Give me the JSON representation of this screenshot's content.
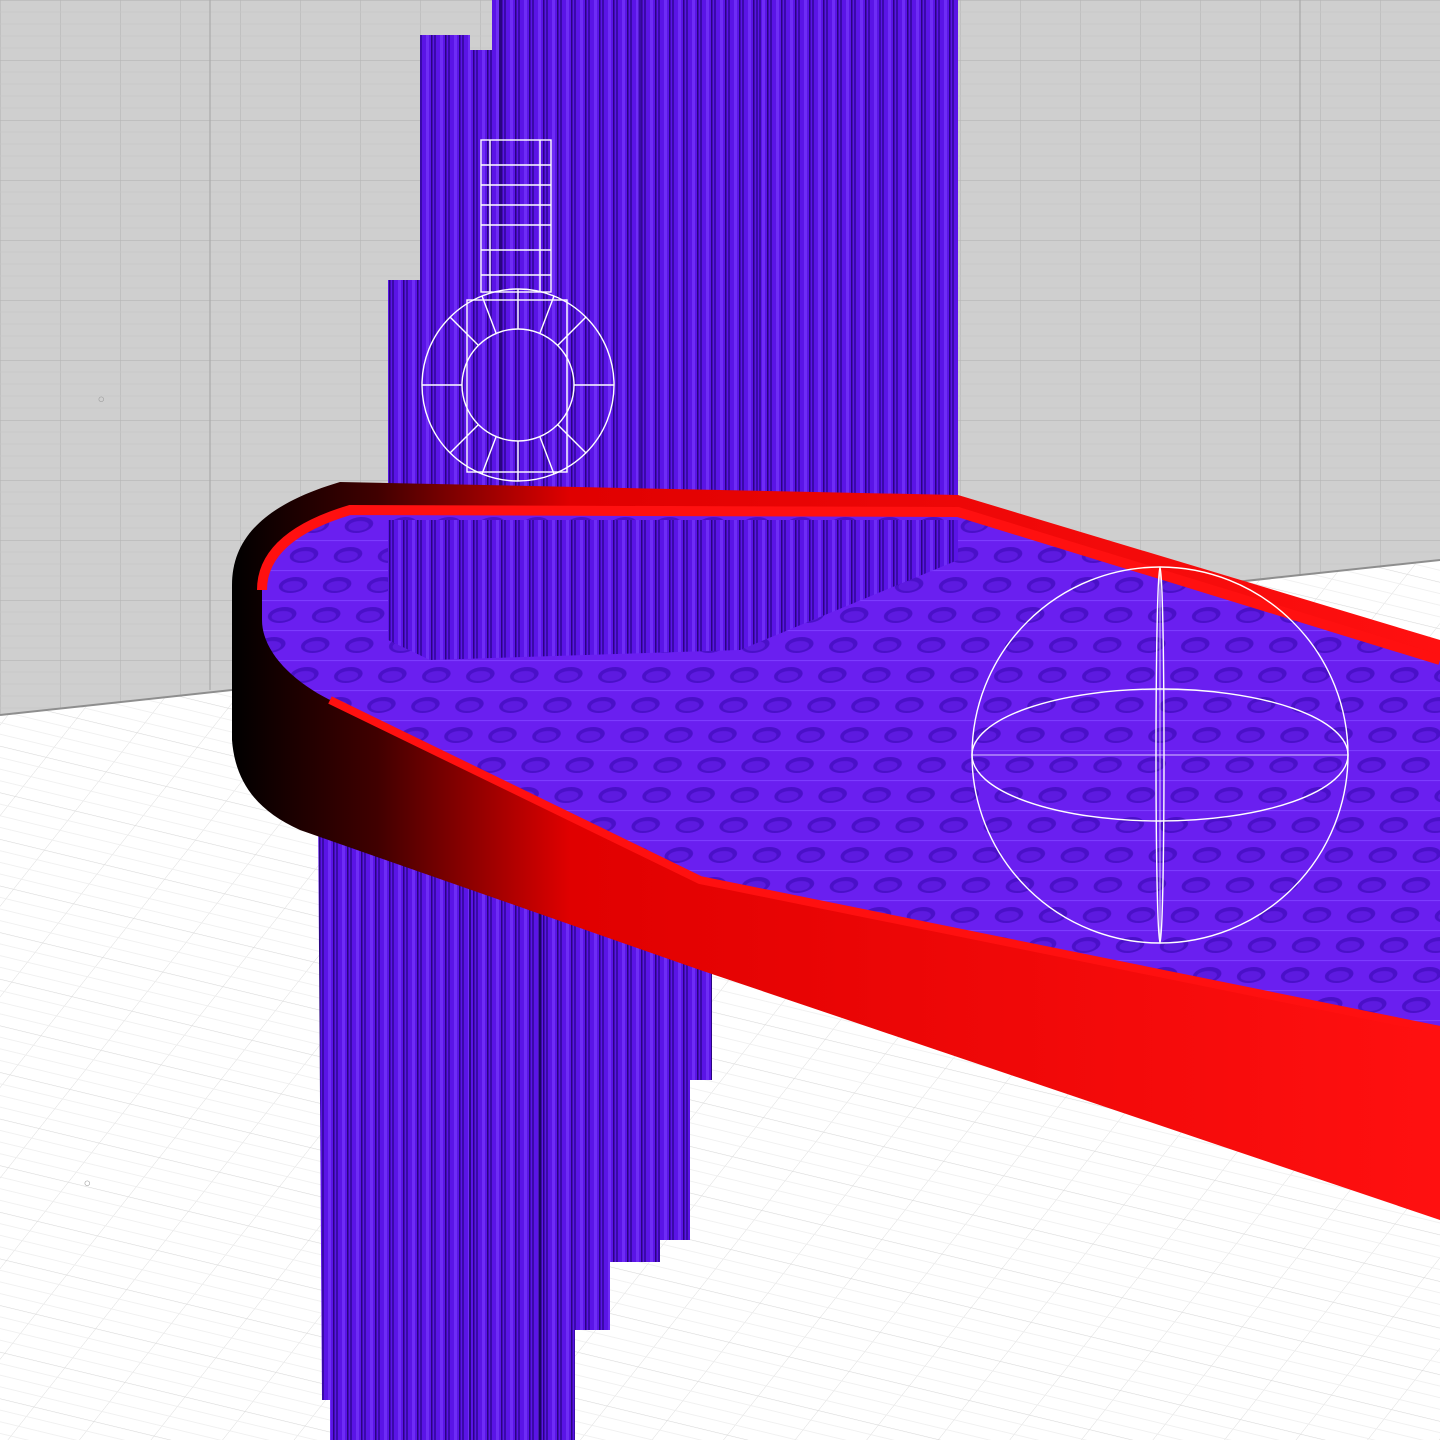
{
  "viewport": {
    "label": "",
    "colors": {
      "back_wall": "#cfcfcf",
      "back_wall_grid": "#b8b8b8",
      "floor": "#ffffff",
      "floor_grid": "#e2e2e2",
      "support_purple": "#5a14e6",
      "support_purple_dark": "#3a0aa8",
      "support_purple_light": "#6e2cf5",
      "raft_red": "#ff1010",
      "raft_red_dark": "#d00000",
      "raft_inner": "#6a1ff0",
      "gizmo_white": "#ffffff",
      "shadow_black": "#000000"
    },
    "icons": {
      "rotate_gizmo": "sphere-rotate-gizmo-icon",
      "ring_gizmo": "ring-gizmo-icon"
    }
  }
}
